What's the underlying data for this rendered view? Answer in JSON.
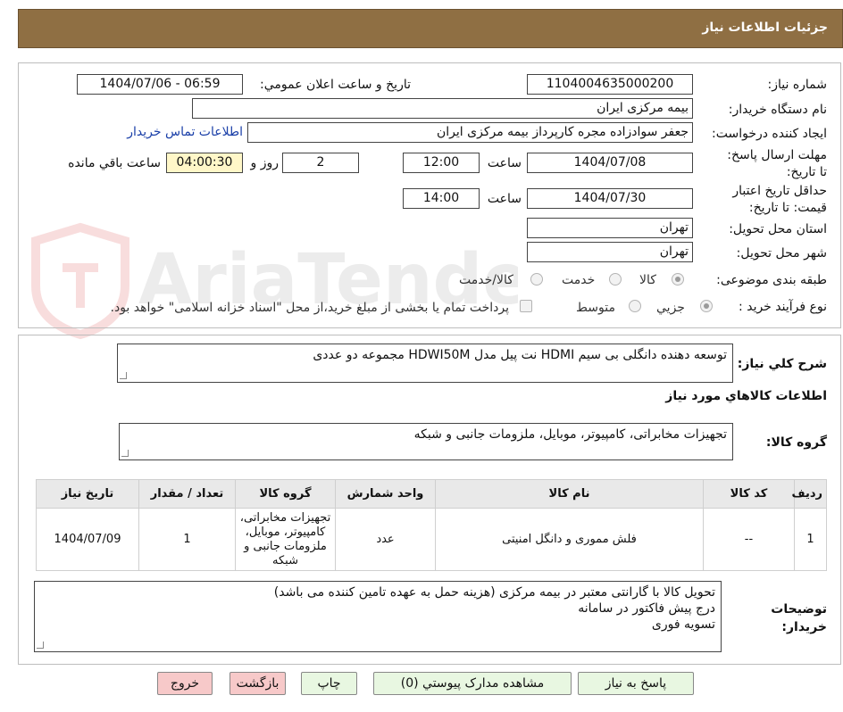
{
  "header": {
    "title": "جزئیات اطلاعات نیاز"
  },
  "watermark": {
    "text": "AriaTender.neT"
  },
  "form": {
    "need_number": {
      "label": "شماره نیاز:",
      "value": "1104004635000200"
    },
    "announce": {
      "label": "تاریخ و ساعت اعلان عمومي:",
      "value": "1404/07/06 - 06:59"
    },
    "buyer_org": {
      "label": "نام دستگاه خریدار:",
      "value": "بیمه مرکزی ایران"
    },
    "requester": {
      "label": "ایجاد کننده درخواست:",
      "value": "جعفر سوادزاده مجره کارپرداز بیمه مرکزی ایران",
      "contact_link": "اطلاعات تماس خریدار"
    },
    "deadline": {
      "label": "مهلت ارسال پاسخ: تا تاریخ:",
      "date": "1404/07/08",
      "time_label": "ساعت",
      "time": "12:00",
      "days": "2",
      "days_label": "روز و",
      "remaining": "04:00:30",
      "remaining_label": "ساعت باقي مانده"
    },
    "validity": {
      "label": "حداقل تاریخ اعتبار قیمت: تا تاریخ:",
      "date": "1404/07/30",
      "time_label": "ساعت",
      "time": "14:00"
    },
    "province": {
      "label": "استان محل تحویل:",
      "value": "تهران"
    },
    "city": {
      "label": "شهر محل تحویل:",
      "value": "تهران"
    },
    "category": {
      "label": "طبقه بندی موضوعی:",
      "options": [
        "کالا",
        "خدمت",
        "کالا/خدمت"
      ],
      "selected": "کالا"
    },
    "process": {
      "label": "نوع فرآیند خرید :",
      "options": [
        "جزیي",
        "متوسط"
      ],
      "selected": "جزیي",
      "payment_note": "پرداخت تمام یا بخشی از مبلغ خرید،از محل \"اسناد خزانه اسلامی\" خواهد بود."
    }
  },
  "summary": {
    "label": "شرح کلي نیاز:",
    "value": "توسعه دهنده دانگلی بی سیم HDMI نت پیل مدل HDWI50M مجموعه دو عددی"
  },
  "goods": {
    "title": "اطلاعات کالاهاي مورد نیاز",
    "group_label": "گروه کالا:",
    "group_value": "تجهیزات مخابراتی، کامپیوتر، موبایل، ملزومات جانبی و شبکه"
  },
  "table": {
    "headers": [
      "ردیف",
      "کد کالا",
      "نام کالا",
      "واحد شمارش",
      "گروه کالا",
      "تعداد / مقدار",
      "تاریخ نیاز"
    ],
    "rows": [
      [
        "1",
        "--",
        "فلش مموری و دانگل امنیتی",
        "عدد",
        "تجهیزات مخابراتی، کامپیوتر، موبایل، ملزومات جانبی و شبکه",
        "1",
        "1404/07/09"
      ]
    ]
  },
  "notes": {
    "label": "توضیحات خریدار:",
    "lines": [
      "تحویل کالا با گارانتی معتبر در بیمه مرکزی (هزینه حمل به عهده تامین کننده می باشد)",
      "درج پیش فاکتور در سامانه",
      "تسویه فوری"
    ]
  },
  "buttons": {
    "reply": "پاسخ به نیاز",
    "attachments": "مشاهده مدارک پیوستي (0)",
    "print": "چاپ",
    "back": "بازگشت",
    "exit": "خروج"
  }
}
